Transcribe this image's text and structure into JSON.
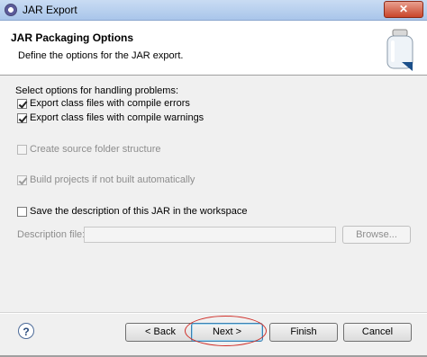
{
  "window": {
    "title": "JAR Export",
    "close_label": "✕"
  },
  "banner": {
    "title": "JAR Packaging Options",
    "description": "Define the options for the JAR export."
  },
  "options": {
    "section_label": "Select options for handling problems:",
    "export_errors": {
      "label": "Export class files with compile errors",
      "checked": true
    },
    "export_warnings": {
      "label": "Export class files with compile warnings",
      "checked": true
    },
    "create_source_folder": {
      "label": "Create source folder structure",
      "checked": false,
      "enabled": false
    },
    "build_projects": {
      "label": "Build projects if not built automatically",
      "checked": true,
      "enabled": false
    },
    "save_description": {
      "label": "Save the description of this JAR in the workspace",
      "checked": false
    }
  },
  "description_file": {
    "label": "Description file:",
    "value": "",
    "browse_label": "Browse..."
  },
  "footer": {
    "help_label": "?",
    "back_label": "< Back",
    "next_label": "Next >",
    "finish_label": "Finish",
    "cancel_label": "Cancel"
  },
  "colors": {
    "annotation": "#d0302a",
    "title_bar": "#b9d1ef"
  }
}
